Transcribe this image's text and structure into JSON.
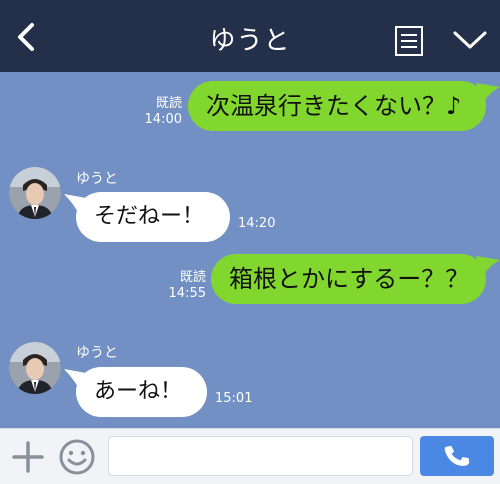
{
  "header": {
    "title": "ゆうと",
    "back_icon": "chevron-left-icon",
    "menu_icon": "list-icon",
    "expand_icon": "chevron-down-icon"
  },
  "messages": [
    {
      "direction": "out",
      "text": "次温泉行きたくない？♪",
      "read": "既読",
      "time": "14:00"
    },
    {
      "direction": "in",
      "sender": "ゆうと",
      "text": "そだねー！",
      "time": "14:20"
    },
    {
      "direction": "out",
      "text": "箱根とかにするー？？",
      "read": "既読",
      "time": "14:55"
    },
    {
      "direction": "in",
      "sender": "ゆうと",
      "text": "あーね！",
      "time": "15:01"
    }
  ],
  "footer": {
    "add_icon": "plus-icon",
    "emoji_icon": "smiley-icon",
    "input_value": "",
    "call_icon": "phone-icon"
  },
  "colors": {
    "header_bg": "#24304a",
    "chat_bg": "#7290c3",
    "outgoing_bubble": "#82d72f",
    "incoming_bubble": "#ffffff",
    "call_button": "#4a88e3"
  }
}
